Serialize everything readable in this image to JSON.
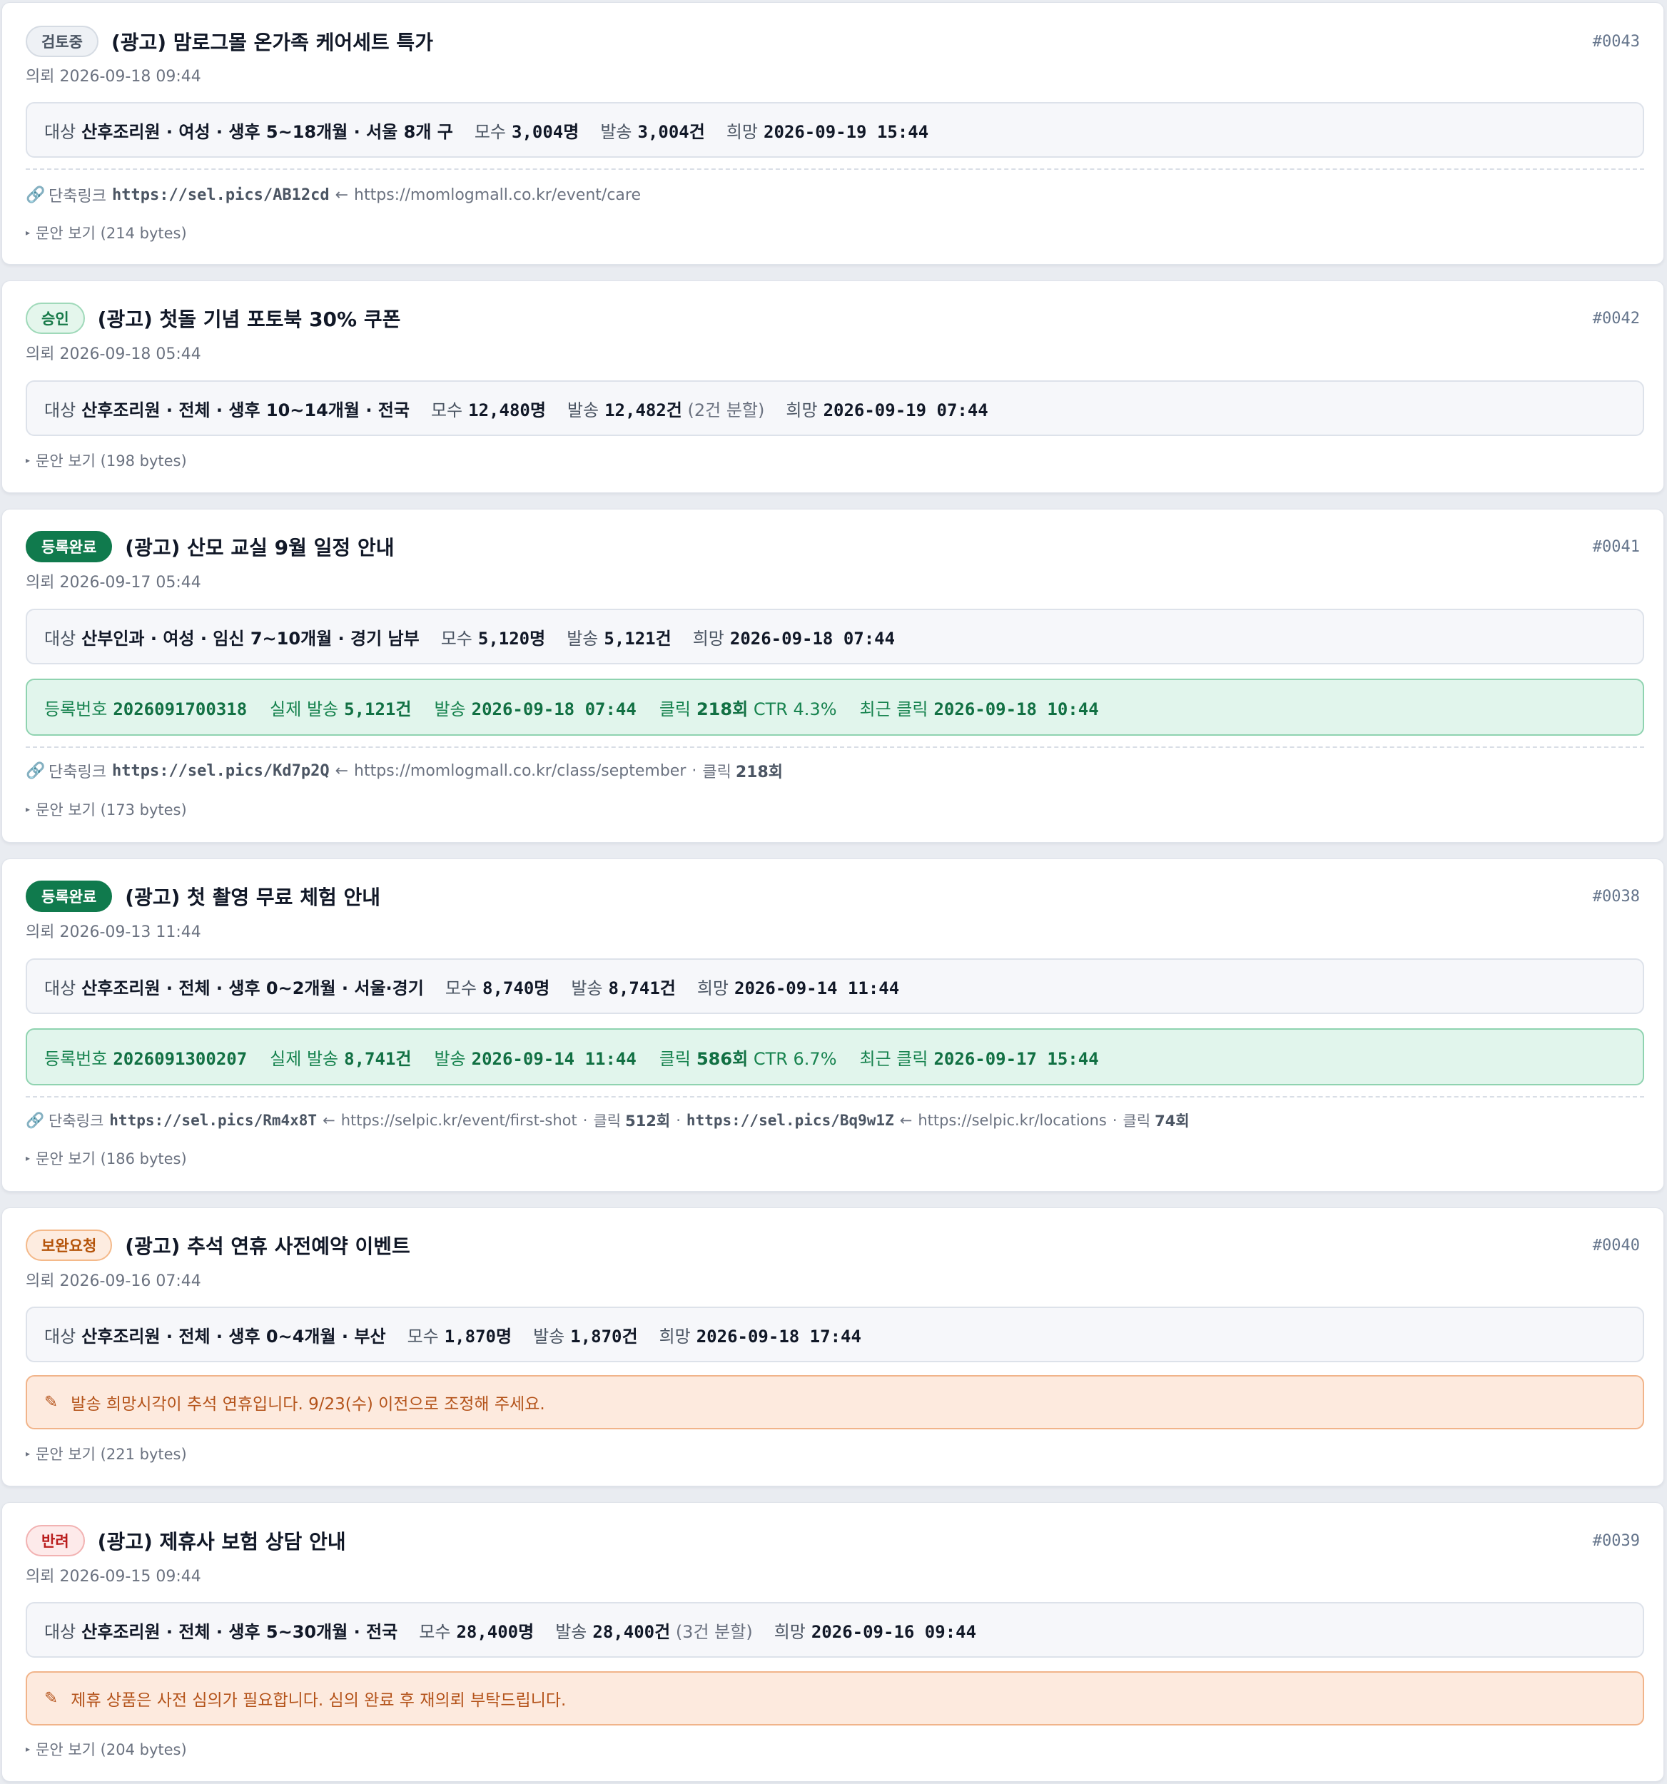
{
  "labels": {
    "target": "대상",
    "population": "모수",
    "send": "발송",
    "desired": "희망",
    "reg_no": "등록번호",
    "actual_send": "실제 발송",
    "sent_at": "발송",
    "clicks": "클릭",
    "recent_click": "최근 클릭",
    "short_link": "단축링크",
    "arrow": "←",
    "dot": "·",
    "click_word": "클릭"
  },
  "cards": [
    {
      "id": "#0043",
      "status": "검토중",
      "title": "(광고) 맘로그몰 온가족 케어세트 특가",
      "requested": "의뢰 2026-09-18 09:44",
      "target": "산후조리원 · 여성 · 생후 5~18개월 · 서울 8개 구",
      "population": "3,004명",
      "send": "3,004건",
      "desired": "2026-09-19 15:44",
      "link1_short": "https://sel.pics/AB12cd",
      "link1_url": "https://momlogmall.co.kr/event/care",
      "toggle": "문안 보기 (214 bytes)"
    },
    {
      "id": "#0042",
      "status": "승인",
      "title": "(광고) 첫돌 기념 포토북 30% 쿠폰",
      "requested": "의뢰 2026-09-18 05:44",
      "target": "산후조리원 · 전체 · 생후 10~14개월 · 전국",
      "population": "12,480명",
      "send": "12,482건",
      "send_note": "(2건 분할)",
      "desired": "2026-09-19 07:44",
      "toggle": "문안 보기 (198 bytes)"
    },
    {
      "id": "#0041",
      "status": "등록완료",
      "title": "(광고) 산모 교실 9월 일정 안내",
      "requested": "의뢰 2026-09-17 05:44",
      "target": "산부인과 · 여성 · 임신 7~10개월 · 경기 남부",
      "population": "5,120명",
      "send": "5,121건",
      "desired": "2026-09-18 07:44",
      "reg_no": "2026091700318",
      "actual_send": "5,121건",
      "sent_at": "2026-09-18 07:44",
      "clicks": "218회",
      "ctr": "CTR 4.3%",
      "recent_click": "2026-09-18 10:44",
      "link1_short": "https://sel.pics/Kd7p2Q",
      "link1_url": "https://momlogmall.co.kr/class/september",
      "link1_clicks": "218회",
      "toggle": "문안 보기 (173 bytes)"
    },
    {
      "id": "#0038",
      "status": "등록완료",
      "title": "(광고) 첫 촬영 무료 체험 안내",
      "requested": "의뢰 2026-09-13 11:44",
      "target": "산후조리원 · 전체 · 생후 0~2개월 · 서울·경기",
      "population": "8,740명",
      "send": "8,741건",
      "desired": "2026-09-14 11:44",
      "reg_no": "2026091300207",
      "actual_send": "8,741건",
      "sent_at": "2026-09-14 11:44",
      "clicks": "586회",
      "ctr": "CTR 6.7%",
      "recent_click": "2026-09-17 15:44",
      "link1_short": "https://sel.pics/Rm4x8T",
      "link1_url": "https://selpic.kr/event/first-shot",
      "link1_clicks": "512회",
      "link2_short": "https://sel.pics/Bq9w1Z",
      "link2_url": "https://selpic.kr/locations",
      "link2_clicks": "74회",
      "toggle": "문안 보기 (186 bytes)"
    },
    {
      "id": "#0040",
      "status": "보완요청",
      "title": "(광고) 추석 연휴 사전예약 이벤트",
      "requested": "의뢰 2026-09-16 07:44",
      "target": "산후조리원 · 전체 · 생후 0~4개월 · 부산",
      "population": "1,870명",
      "send": "1,870건",
      "desired": "2026-09-18 17:44",
      "note": "발송 희망시각이 추석 연휴입니다. 9/23(수) 이전으로 조정해 주세요.",
      "toggle": "문안 보기 (221 bytes)"
    },
    {
      "id": "#0039",
      "status": "반려",
      "title": "(광고) 제휴사 보험 상담 안내",
      "requested": "의뢰 2026-09-15 09:44",
      "target": "산후조리원 · 전체 · 생후 5~30개월 · 전국",
      "population": "28,400명",
      "send": "28,400건",
      "send_note": "(3건 분할)",
      "desired": "2026-09-16 09:44",
      "note": "제휴 상품은 사전 심의가 필요합니다. 심의 완료 후 재의뢰 부탁드립니다.",
      "toggle": "문안 보기 (204 bytes)"
    }
  ],
  "icons": {
    "link": "link-icon",
    "note": "pencil-icon",
    "toggle": "triangle-right-icon"
  }
}
